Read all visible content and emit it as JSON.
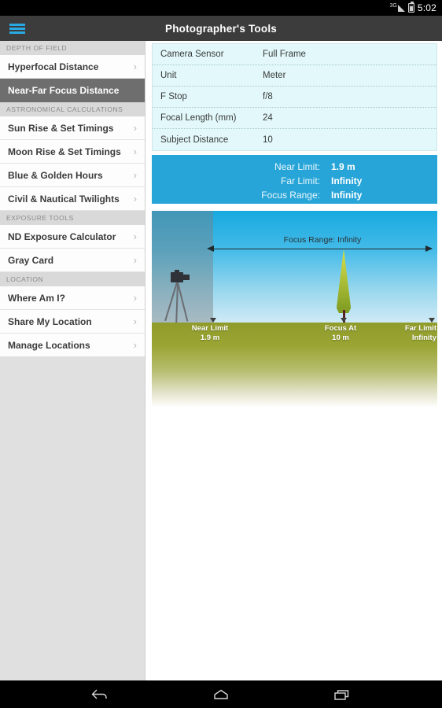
{
  "statusbar": {
    "network": "3G",
    "network_icon": "signal-3g-icon",
    "battery_icon": "battery-icon",
    "time": "5:02"
  },
  "appbar": {
    "menu_icon": "hamburger-menu-icon",
    "title": "Photographer's Tools"
  },
  "sidebar": {
    "sections": [
      {
        "header": "DEPTH OF FIELD",
        "items": [
          {
            "label": "Hyperfocal Distance",
            "selected": false
          },
          {
            "label": "Near-Far Focus Distance",
            "selected": true
          }
        ]
      },
      {
        "header": "ASTRONOMICAL CALCULATIONS",
        "items": [
          {
            "label": "Sun Rise & Set Timings",
            "selected": false
          },
          {
            "label": "Moon Rise & Set Timings",
            "selected": false
          },
          {
            "label": "Blue & Golden Hours",
            "selected": false
          },
          {
            "label": "Civil & Nautical Twilights",
            "selected": false
          }
        ]
      },
      {
        "header": "EXPOSURE TOOLS",
        "items": [
          {
            "label": "ND Exposure Calculator",
            "selected": false
          },
          {
            "label": "Gray Card",
            "selected": false
          }
        ]
      },
      {
        "header": "LOCATION",
        "items": [
          {
            "label": "Where Am I?",
            "selected": false
          },
          {
            "label": "Share My Location",
            "selected": false
          },
          {
            "label": "Manage Locations",
            "selected": false
          }
        ]
      }
    ],
    "chevron_glyph": "›"
  },
  "form": {
    "rows": [
      {
        "label": "Camera Sensor",
        "value": "Full Frame"
      },
      {
        "label": "Unit",
        "value": "Meter"
      },
      {
        "label": "F Stop",
        "value": "f/8"
      },
      {
        "label": "Focal Length (mm)",
        "value": "24"
      },
      {
        "label": "Subject Distance",
        "value": "10"
      }
    ]
  },
  "results": {
    "rows": [
      {
        "label": "Near Limit:",
        "value": "1.9 m"
      },
      {
        "label": "Far Limit:",
        "value": "Infinity"
      },
      {
        "label": "Focus Range:",
        "value": "Infinity"
      }
    ]
  },
  "diagram": {
    "range_label": "Focus  Range: Infinity",
    "near": {
      "title": "Near Limit",
      "value": "1.9 m"
    },
    "focus": {
      "title": "Focus At",
      "value": "10 m"
    },
    "far": {
      "title": "Far Limit",
      "value": "Infinity"
    },
    "camera_icon": "camera-tripod-icon",
    "subject_icon": "tree-icon"
  },
  "navbar": {
    "back_icon": "back-icon",
    "home_icon": "home-icon",
    "recents_icon": "recents-icon"
  },
  "colors": {
    "accent": "#29a9e1",
    "result_panel": "#28a5d8",
    "form_bg": "#e2f8fa",
    "appbar": "#3c3c3c",
    "selected_nav": "#6e6e6e"
  }
}
